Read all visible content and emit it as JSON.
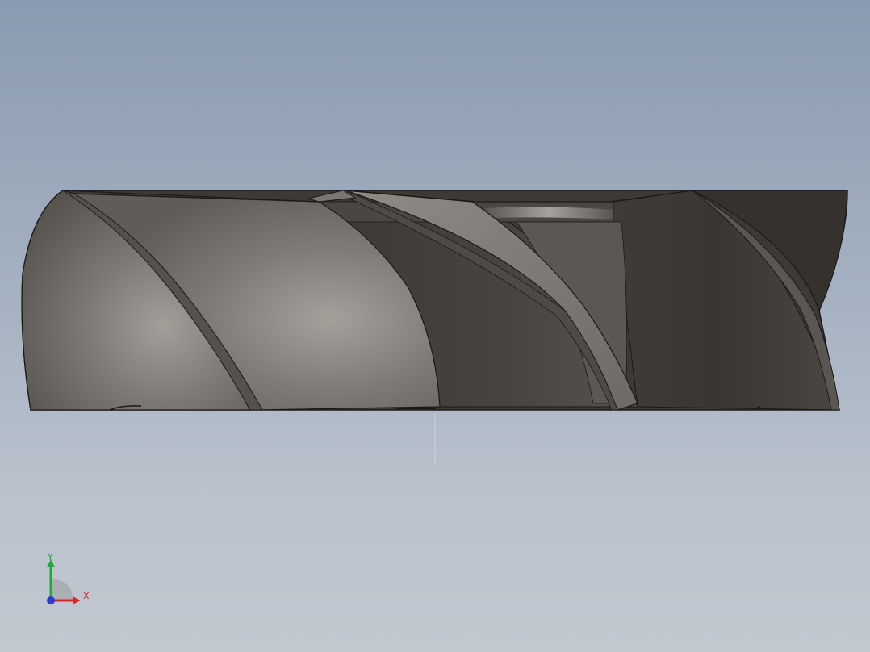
{
  "viewport": {
    "background_top": "#8a9ab0",
    "background_bottom": "#c2c8d0",
    "model": "helical-flute-body"
  },
  "colors": {
    "surface_light": "#9a9690",
    "surface_mid": "#6f6b66",
    "surface_dark": "#3a3632",
    "edge": "#1c1a18",
    "axis_x": "#d22a2a",
    "axis_y": "#22a83a",
    "axis_z": "#2a3ad2"
  },
  "triad": {
    "x_label": "X",
    "y_label": "Y"
  }
}
